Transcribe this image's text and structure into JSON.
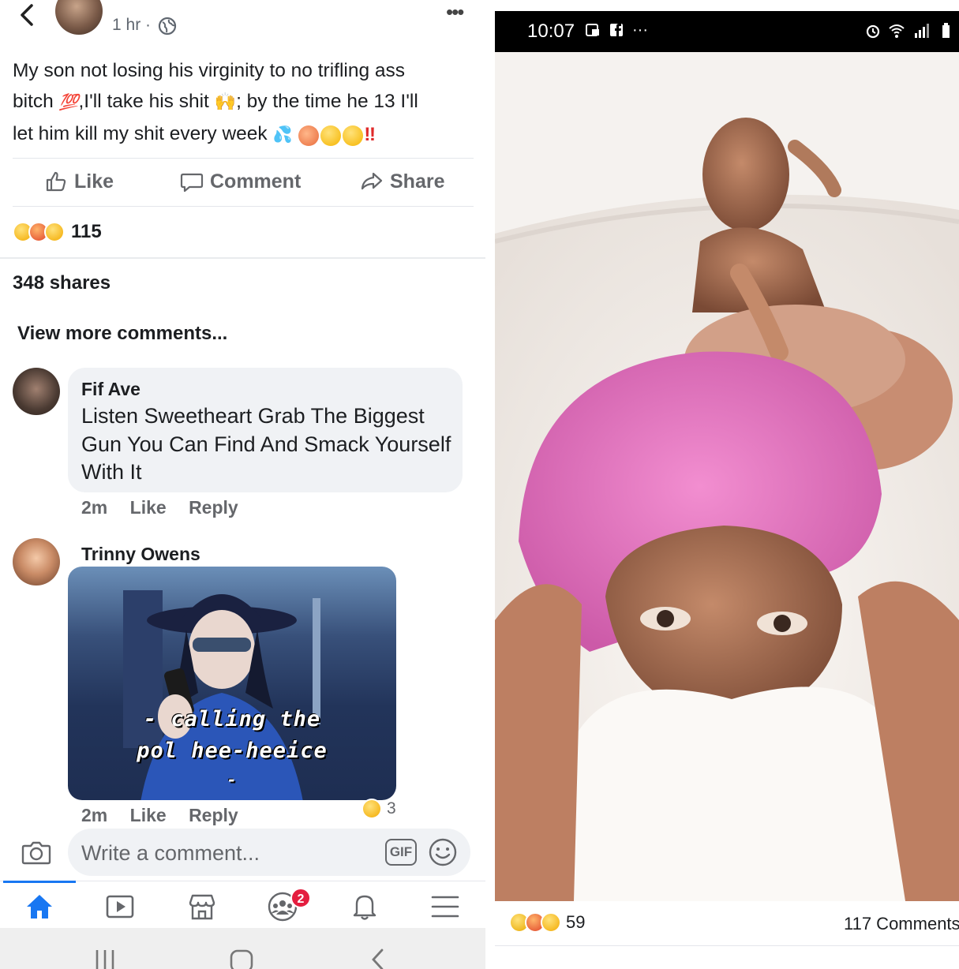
{
  "left_panel": {
    "post": {
      "time": "1 hr ·",
      "text_line1": "My son not losing his virginity to no trifling ass",
      "text_line2a": "bitch",
      "text_line2b": ",I'll take his shit",
      "text_line2c": "; by the time he 13 I'll",
      "text_line3": "let him kill my shit every week",
      "hundred_emoji": "💯",
      "raised_hands_emoji": "🙌",
      "sweat_emoji": "💦",
      "exclaim": "‼"
    },
    "actions": {
      "like": "Like",
      "comment": "Comment",
      "share": "Share"
    },
    "reactions": {
      "count": "115",
      "types": [
        "wow",
        "angry",
        "haha"
      ]
    },
    "shares": "348 shares",
    "view_more": "View more comments...",
    "comments": [
      {
        "author": "Fif Ave",
        "text": "Listen Sweetheart Grab The Biggest Gun You Can Find And Smack Yourself With It",
        "time": "2m",
        "like": "Like",
        "reply": "Reply"
      },
      {
        "author": "Trinny Owens",
        "gif_caption_line1": "- calling the",
        "gif_caption_line2": "pol hee-heeice",
        "gif_caption_line3": "-",
        "time": "2m",
        "like": "Like",
        "reply": "Reply",
        "reaction_count": "3"
      }
    ],
    "compose": {
      "placeholder": "Write a comment...",
      "gif_label": "GIF"
    },
    "nav": {
      "active": "home",
      "badge": "2",
      "icons": [
        "home-icon",
        "watch-icon",
        "marketplace-icon",
        "groups-icon",
        "notifications-icon",
        "menu-icon"
      ]
    },
    "colors": {
      "accent": "#1877f2",
      "badge": "#e41e3f",
      "secondary_text": "#65676b"
    }
  },
  "right_panel": {
    "status_time": "10:07",
    "status_more": "···",
    "reactions_count": "59",
    "comments_count": "117 Comments"
  }
}
